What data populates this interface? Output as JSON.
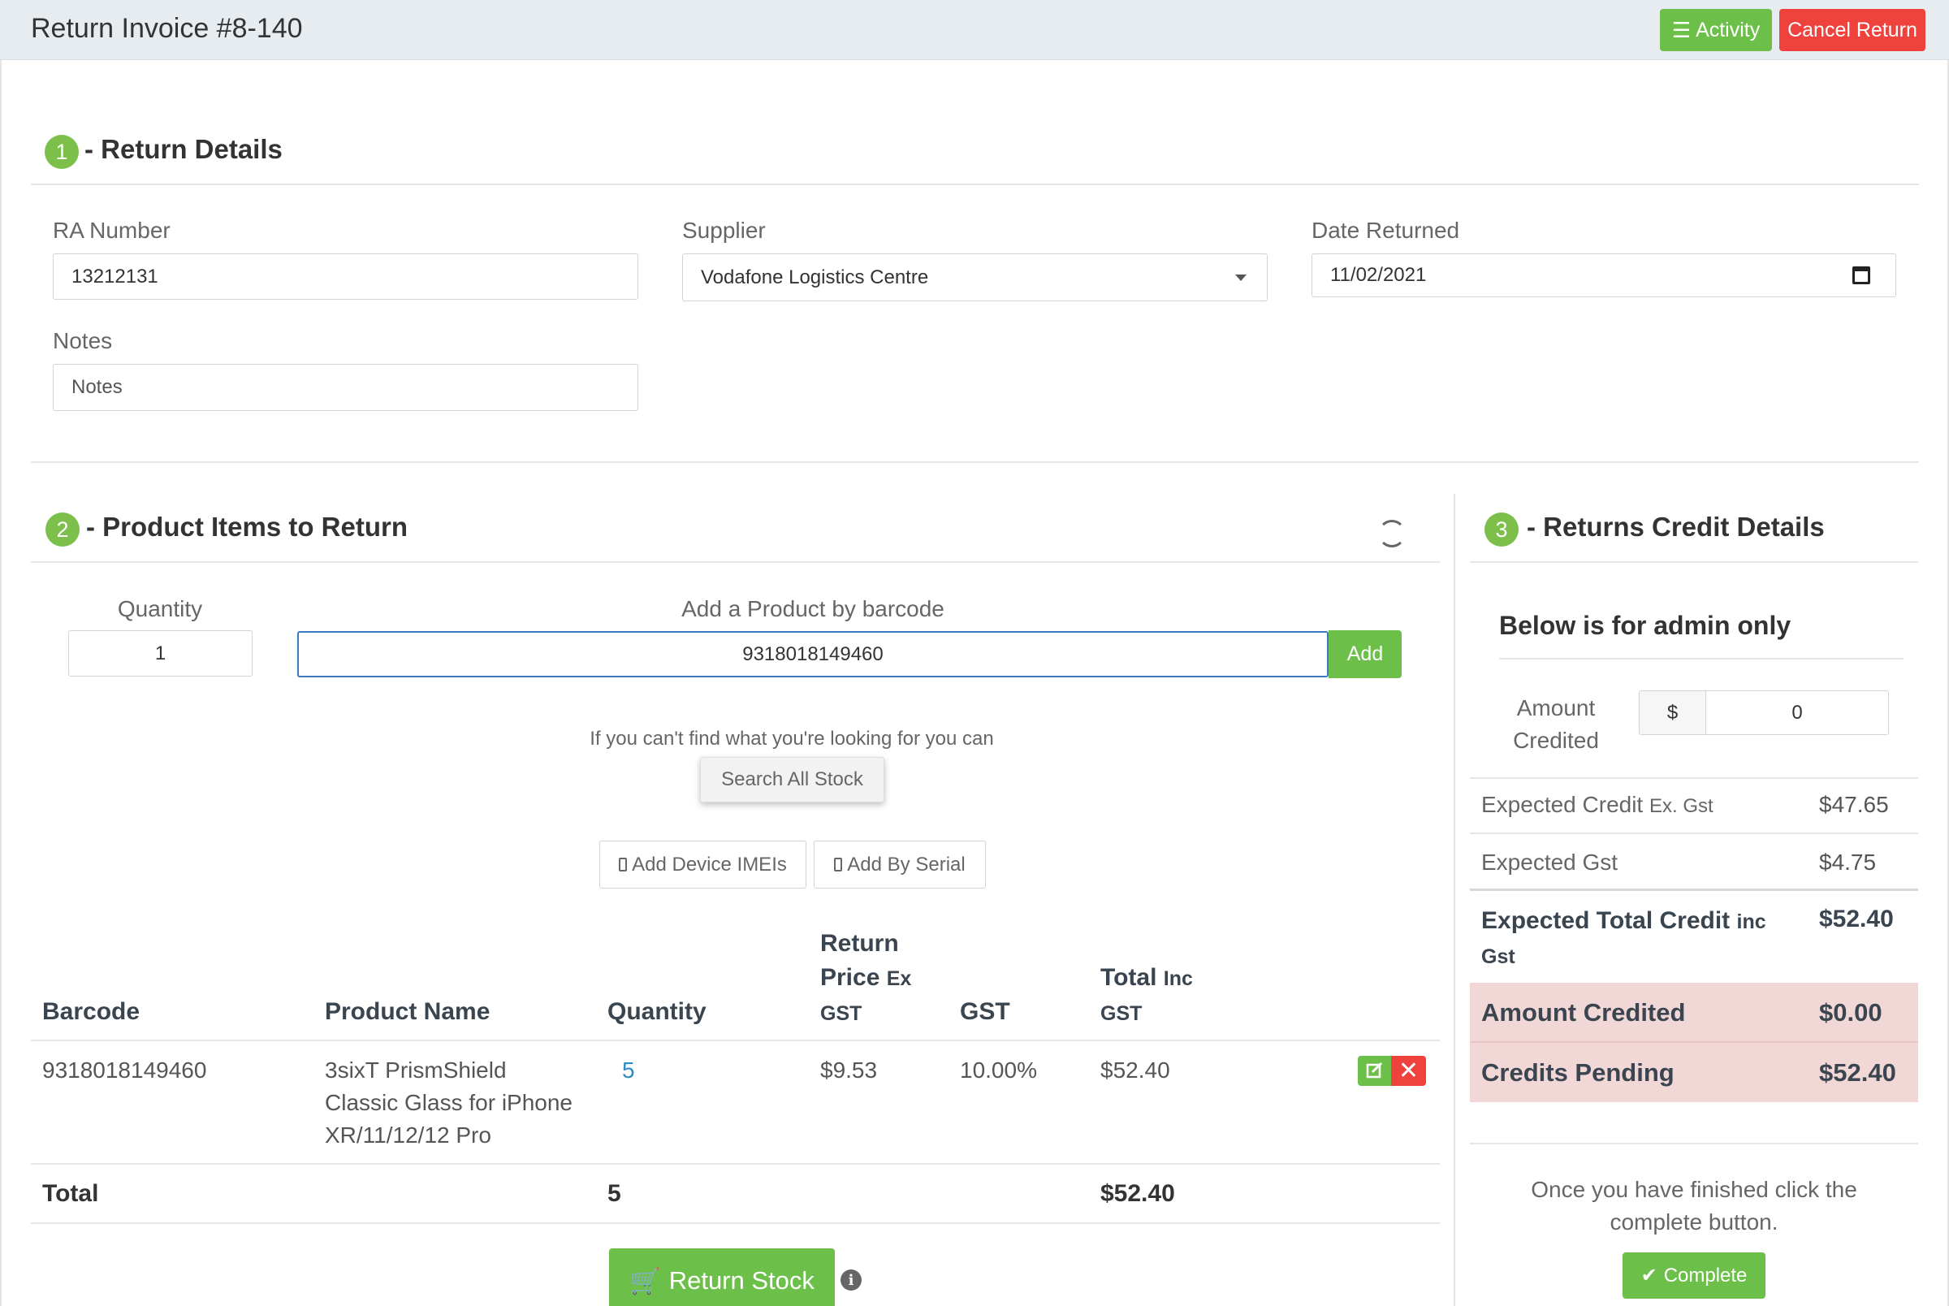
{
  "header": {
    "title": "Return Invoice #8-140",
    "activity_label": "Activity",
    "cancel_label": "Cancel Return"
  },
  "step1": {
    "number": "1",
    "title": "- Return Details",
    "ra_label": "RA Number",
    "ra_value": "13212131",
    "supplier_label": "Supplier",
    "supplier_value": "Vodafone Logistics Centre",
    "date_label": "Date Returned",
    "date_value": "11/02/2021",
    "notes_label": "Notes",
    "notes_placeholder": "Notes"
  },
  "step2": {
    "number": "2",
    "title": "- Product Items to Return",
    "quantity_label": "Quantity",
    "quantity_value": "1",
    "barcode_label": "Add a Product by barcode",
    "barcode_value": "9318018149460",
    "add_label": "Add",
    "hint": "If you can't find what you're looking for you can",
    "search_all_label": "Search All Stock",
    "add_imei_label": "Add Device IMEIs",
    "add_serial_label": "Add By Serial",
    "columns": {
      "barcode": "Barcode",
      "product_name": "Product Name",
      "quantity": "Quantity",
      "return_price_a": "Return",
      "return_price_b": "Price",
      "return_price_c": "Ex",
      "return_price_d": "GST",
      "gst": "GST",
      "total_a": "Total",
      "total_b": "Inc",
      "total_c": "GST"
    },
    "rows": [
      {
        "barcode": "9318018149460",
        "product_line1": "3sixT PrismShield",
        "product_line2": "Classic Glass for iPhone",
        "product_line3": "XR/11/12/12 Pro",
        "quantity": "5",
        "price": "$9.53",
        "gst": "10.00%",
        "total": "$52.40"
      }
    ],
    "total_label": "Total",
    "total_quantity": "5",
    "total_amount": "$52.40",
    "return_stock_label": "Return Stock"
  },
  "step3": {
    "number": "3",
    "title": "- Returns Credit Details",
    "admin_note": "Below is for admin only",
    "amount_credited_label_a": "Amount",
    "amount_credited_label_b": "Credited",
    "currency_symbol": "$",
    "amount_credited_value": "0",
    "expected_credit_label": "Expected Credit",
    "expected_credit_suffix": "Ex. Gst",
    "expected_credit_value": "$47.65",
    "expected_gst_label": "Expected Gst",
    "expected_gst_value": "$4.75",
    "expected_total_label": "Expected Total Credit",
    "expected_total_suffix_a": "inc",
    "expected_total_suffix_b": "Gst",
    "expected_total_value": "$52.40",
    "amount_credited_row_label": "Amount Credited",
    "amount_credited_row_value": "$0.00",
    "credits_pending_label": "Credits Pending",
    "credits_pending_value": "$52.40",
    "finish_line1": "Once you have finished click the",
    "finish_line2": "complete button.",
    "complete_label": "Complete"
  }
}
